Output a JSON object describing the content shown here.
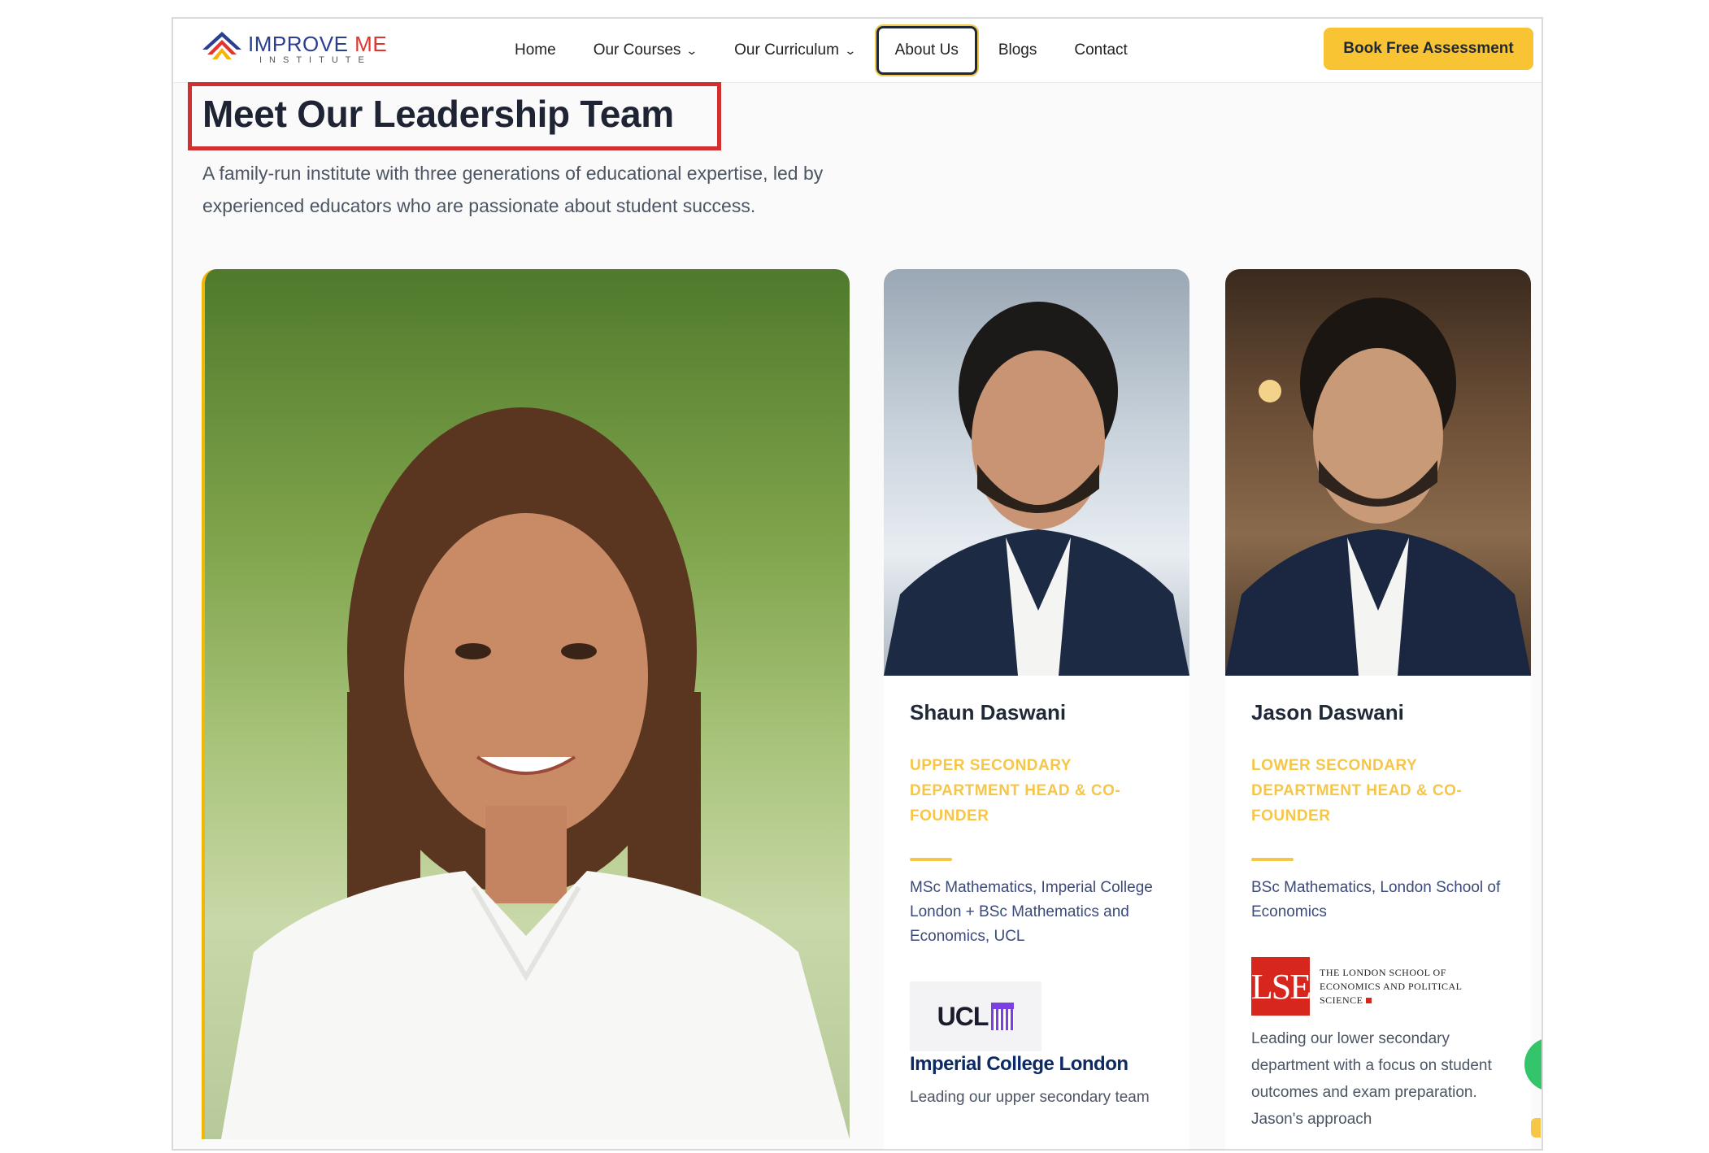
{
  "header": {
    "logo": {
      "name_part1": "IMPROVE",
      "name_part2": "ME",
      "subtitle": "INSTITUTE"
    },
    "nav": [
      {
        "label": "Home",
        "dropdown": false
      },
      {
        "label": "Our Courses",
        "dropdown": true
      },
      {
        "label": "Our Curriculum",
        "dropdown": true
      },
      {
        "label": "About Us",
        "dropdown": false,
        "active": true
      },
      {
        "label": "Blogs",
        "dropdown": false
      },
      {
        "label": "Contact",
        "dropdown": false
      }
    ],
    "cta_label": "Book Free Assessment"
  },
  "section": {
    "title": "Meet Our Leadership Team",
    "intro": "A family-run institute with three generations of educational expertise, led by experienced educators who are passionate about student success."
  },
  "members": [
    {
      "name": "Shaun Daswani",
      "role": "UPPER SECONDARY DEPARTMENT HEAD & CO-FOUNDER",
      "education": "MSc Mathematics, Imperial College London + BSc Mathematics and Economics, UCL",
      "logos": [
        "UCL",
        "Imperial College London"
      ],
      "bio": "Leading our upper secondary team"
    },
    {
      "name": "Jason Daswani",
      "role": "LOWER SECONDARY DEPARTMENT HEAD & CO-FOUNDER",
      "education": "BSc Mathematics, London School of Economics",
      "logos": [
        "LSE",
        "THE LONDON SCHOOL OF ECONOMICS AND POLITICAL SCIENCE"
      ],
      "bio": "Leading our lower secondary department with a focus on student outcomes and exam preparation. Jason's approach"
    }
  ],
  "colors": {
    "accent_yellow": "#f9c433",
    "role_yellow": "#f5c648",
    "highlight_red": "#d32f2f",
    "heading_dark": "#1e2433"
  }
}
